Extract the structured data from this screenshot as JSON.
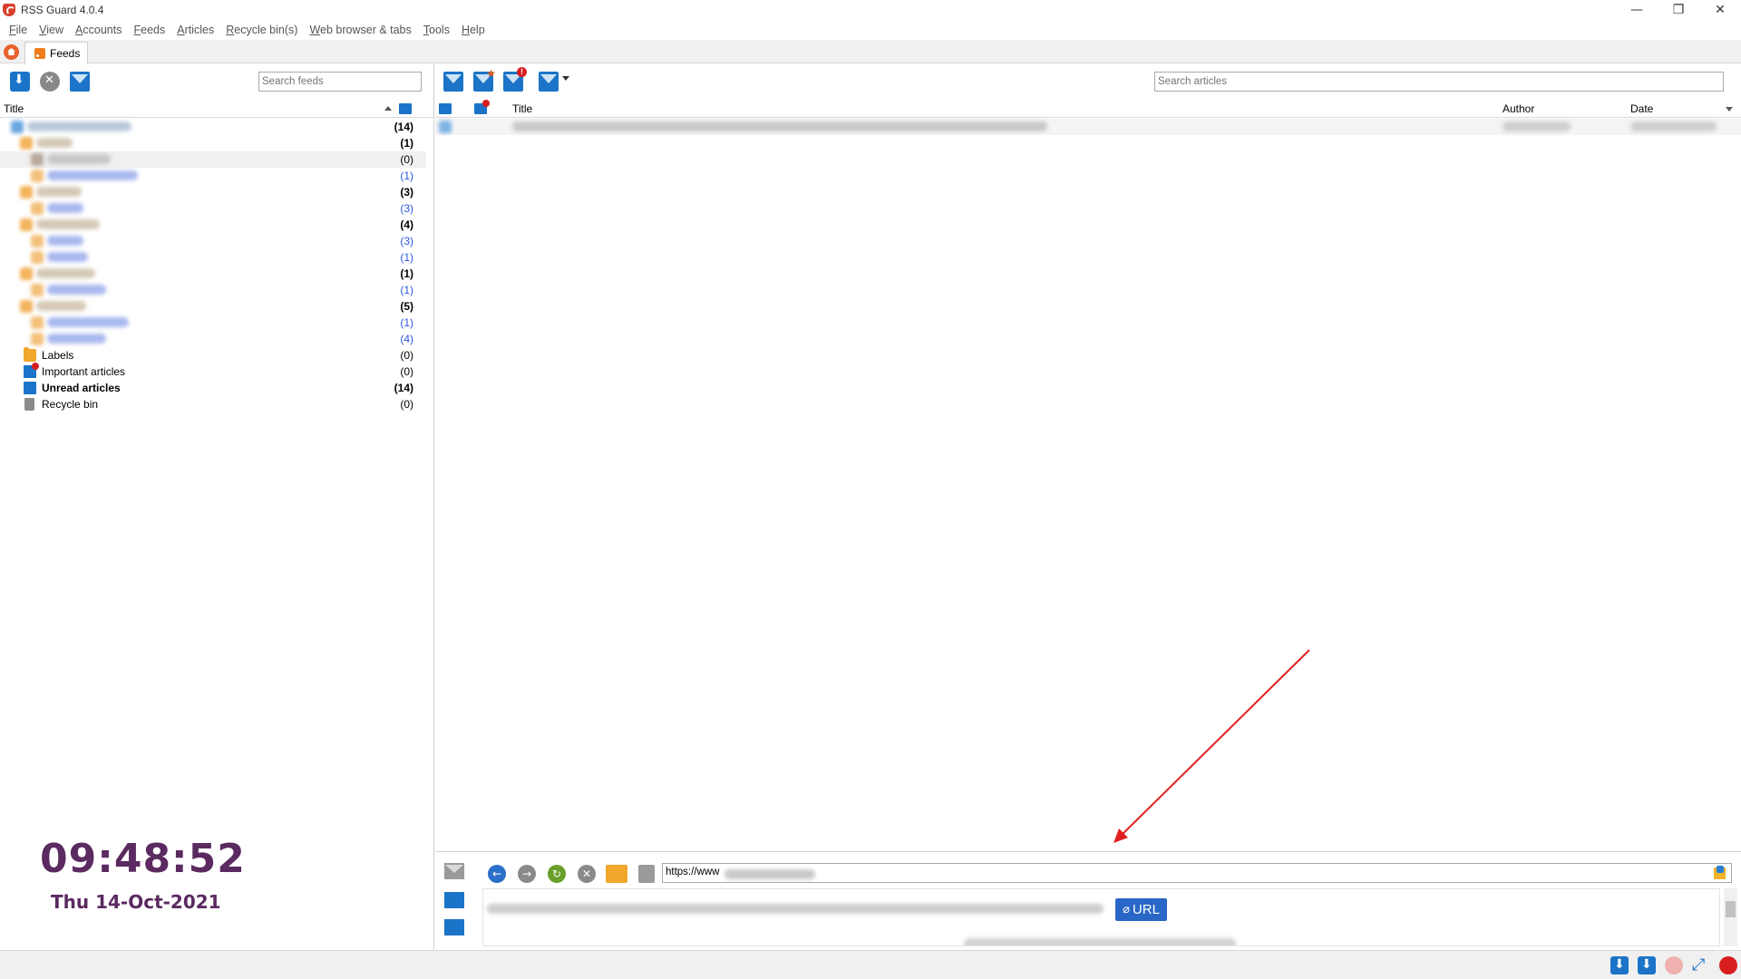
{
  "window": {
    "title": "RSS Guard 4.0.4",
    "controls": [
      "—",
      "❐",
      "✕"
    ]
  },
  "menu": [
    {
      "acc": "F",
      "rest": "ile"
    },
    {
      "acc": "V",
      "rest": "iew"
    },
    {
      "acc": "A",
      "rest": "ccounts"
    },
    {
      "acc": "F",
      "rest": "eeds"
    },
    {
      "acc": "A",
      "rest": "rticles"
    },
    {
      "acc": "R",
      "rest": "ecycle bin(s)"
    },
    {
      "acc": "W",
      "rest": "eb browser & tabs"
    },
    {
      "acc": "T",
      "rest": "ools"
    },
    {
      "acc": "H",
      "rest": "elp"
    }
  ],
  "tabs": {
    "feeds_label": "Feeds"
  },
  "feeds_panel": {
    "search_placeholder": "Search feeds",
    "col_title": "Title",
    "tree_counts": [
      "(14)",
      "(1)",
      "(0)",
      "(1)",
      "(3)",
      "(3)",
      "(4)",
      "(3)",
      "(1)",
      "(1)",
      "(1)",
      "(5)",
      "(1)",
      "(4)"
    ],
    "special_items": [
      {
        "label": "Labels",
        "count": "(0)",
        "icon": "labels-folder-icon",
        "bold": false
      },
      {
        "label": "Important articles",
        "count": "(0)",
        "icon": "important-icon",
        "bold": false
      },
      {
        "label": "Unread articles",
        "count": "(14)",
        "icon": "unread-icon",
        "bold": true
      },
      {
        "label": "Recycle bin",
        "count": "(0)",
        "icon": "recycle-bin-icon",
        "bold": false
      }
    ]
  },
  "clock": {
    "time": "09:48:52",
    "date": "Thu 14-Oct-2021"
  },
  "articles_panel": {
    "search_placeholder": "Search articles",
    "col_title": "Title",
    "col_author": "Author",
    "col_date": "Date"
  },
  "viewer": {
    "url": "https://www",
    "url_badge": "URL"
  },
  "colors": {
    "accent_blue": "#1b74c8",
    "clock": "#5a2a60",
    "badge": "#2967c6",
    "arrow": "#e02020"
  }
}
